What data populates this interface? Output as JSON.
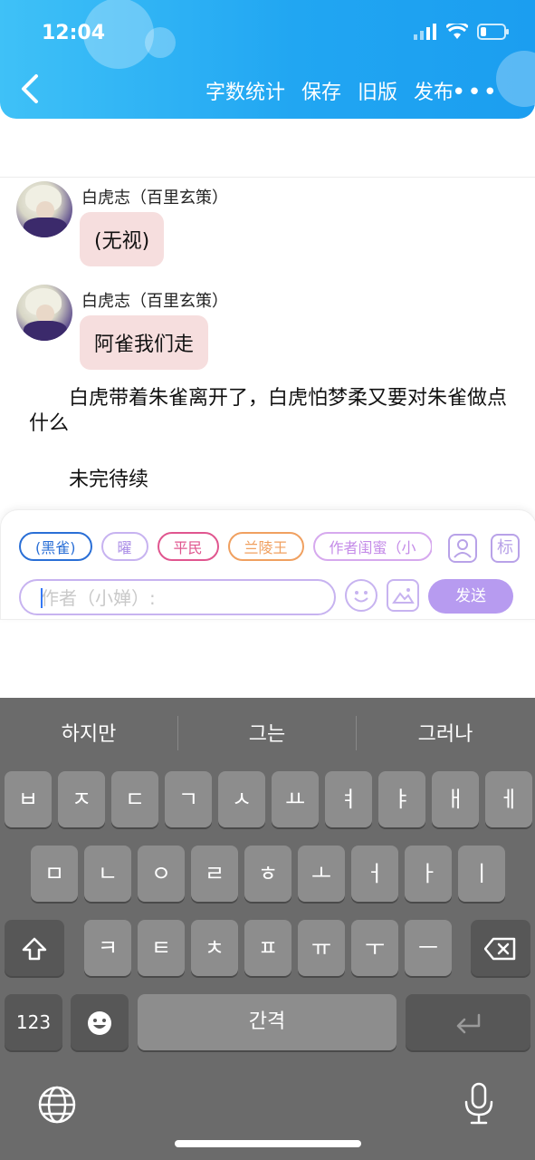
{
  "status_bar": {
    "time": "12:04"
  },
  "header": {
    "actions": [
      "字数统计",
      "保存",
      "旧版",
      "发布"
    ],
    "more_label": "•••"
  },
  "messages": [
    {
      "name": "白虎志（百里玄策）",
      "text": "(无视)"
    },
    {
      "name": "白虎志（百里玄策）",
      "text": "阿雀我们走"
    }
  ],
  "narration": "白虎带着朱雀离开了，白虎怕梦柔又要对朱雀做点什么",
  "to_be_continued": "未完待续",
  "composer": {
    "chips": [
      {
        "label": "(黑雀)",
        "color": "#2a6fd6"
      },
      {
        "label": "曜",
        "color": "#a98be6"
      },
      {
        "label": "平民",
        "color": "#e0568f"
      },
      {
        "label": "兰陵王",
        "color": "#f0a060"
      },
      {
        "label": "作者闺蜜（小",
        "color": "#c48be8"
      }
    ],
    "side_icons": [
      "person-icon",
      "tag-icon"
    ],
    "tag_label": "标",
    "placeholder": "作者（小婵）:",
    "send_label": "发送"
  },
  "keyboard": {
    "suggestions": [
      "하지만",
      "그는",
      "그러나"
    ],
    "row1": [
      "ㅂ",
      "ㅈ",
      "ㄷ",
      "ㄱ",
      "ㅅ",
      "ㅛ",
      "ㅕ",
      "ㅑ",
      "ㅐ",
      "ㅔ"
    ],
    "row2": [
      "ㅁ",
      "ㄴ",
      "ㅇ",
      "ㄹ",
      "ㅎ",
      "ㅗ",
      "ㅓ",
      "ㅏ",
      "ㅣ"
    ],
    "row3": [
      "ㅋ",
      "ㅌ",
      "ㅊ",
      "ㅍ",
      "ㅠ",
      "ㅜ",
      "ㅡ"
    ],
    "numbers_label": "123",
    "space_label": "간격"
  }
}
